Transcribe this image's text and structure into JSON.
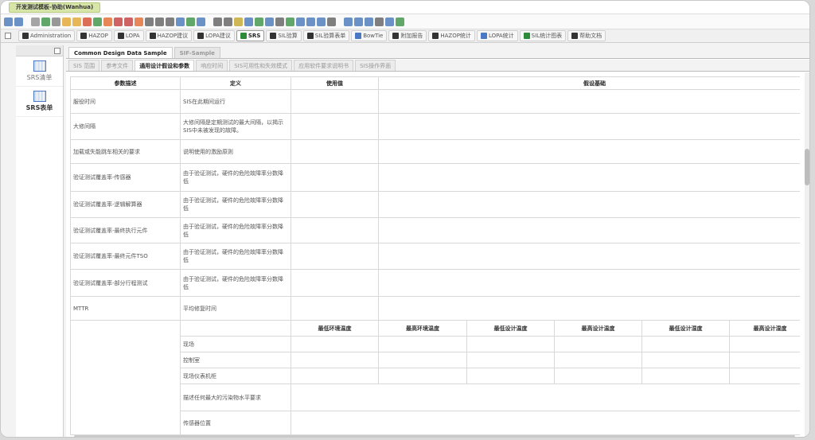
{
  "window": {
    "title": "开发测试模板-协助(Wanhua)"
  },
  "nav": [
    {
      "label": "Administration",
      "active": false,
      "icon": "module-icon"
    },
    {
      "label": "HAZOP",
      "active": false,
      "icon": "module-icon"
    },
    {
      "label": "LOPA",
      "active": false,
      "icon": "module-icon"
    },
    {
      "label": "HAZOP建议",
      "active": false,
      "icon": "module-icon"
    },
    {
      "label": "LOPA建议",
      "active": false,
      "icon": "module-icon"
    },
    {
      "label": "SRS",
      "active": true,
      "icon": "module-icon"
    },
    {
      "label": "SIL验算",
      "active": false,
      "icon": "module-icon"
    },
    {
      "label": "SIL验算表单",
      "active": false,
      "icon": "module-icon"
    },
    {
      "label": "BowTie",
      "active": false,
      "icon": "module-icon"
    },
    {
      "label": "附加报告",
      "active": false,
      "icon": "module-icon"
    },
    {
      "label": "HAZOP统计",
      "active": false,
      "icon": "module-icon"
    },
    {
      "label": "LOPA统计",
      "active": false,
      "icon": "module-icon"
    },
    {
      "label": "SIL统计图表",
      "active": false,
      "icon": "module-icon"
    },
    {
      "label": "帮助文档",
      "active": false,
      "icon": "help-icon"
    }
  ],
  "side": [
    {
      "label": "SRS清单",
      "active": false
    },
    {
      "label": "SRS表单",
      "active": true
    }
  ],
  "doc_tabs": [
    {
      "label": "Common Design Data Sample",
      "active": true
    },
    {
      "label": "SIF-Sample",
      "active": false
    }
  ],
  "sub_tabs": [
    {
      "label": "SIS 范围",
      "active": false
    },
    {
      "label": "参考文件",
      "active": false
    },
    {
      "label": "通用设计假设和参数",
      "active": true
    },
    {
      "label": "响应时间",
      "active": false
    },
    {
      "label": "SIS可用性和失效模式",
      "active": false
    },
    {
      "label": "应用软件要求说明书",
      "active": false
    },
    {
      "label": "SIS操作界面",
      "active": false
    }
  ],
  "table": {
    "headers": [
      "参数描述",
      "定义",
      "使用值",
      "假设基础"
    ],
    "rows": [
      {
        "param": "服役时间",
        "def": "SIS在此期间运行"
      },
      {
        "param": "大修间隔",
        "def": "大修间隔是定期测试的最大间隔，以揭示SIS中未被发现的故障。"
      },
      {
        "param": "加载或失能跳车相关的要求",
        "def": "说明使用的激励原则"
      },
      {
        "param": "验证测试覆盖率-传感器",
        "def": "由于验证测试，硬件的危险故障率分数降低"
      },
      {
        "param": "验证测试覆盖率-逻辑解算器",
        "def": "由于验证测试，硬件的危险故障率分数降低"
      },
      {
        "param": "验证测试覆盖率-最终执行元件",
        "def": "由于验证测试，硬件的危险故障率分数降低"
      },
      {
        "param": "验证测试覆盖率-最终元件TSO",
        "def": "由于验证测试，硬件的危险故障率分数降低"
      },
      {
        "param": "验证测试覆盖率-部分行程测试",
        "def": "由于验证测试，硬件的危险故障率分数降低"
      },
      {
        "param": "MTTR",
        "def": "平均修复时间"
      }
    ],
    "env_headers": [
      "最低环境温度",
      "最高环境温度",
      "最低设计温度",
      "最高设计温度",
      "最低设计湿度",
      "最高设计湿度"
    ],
    "env_rows": [
      "现场",
      "控制室",
      "现场仪表机柜"
    ],
    "extra_rows": [
      "描述任何最大的污染物水平要求",
      "传感器位置"
    ]
  },
  "colors": {
    "title_tab": "#d7e6a8",
    "accent": "#4a78c4"
  }
}
